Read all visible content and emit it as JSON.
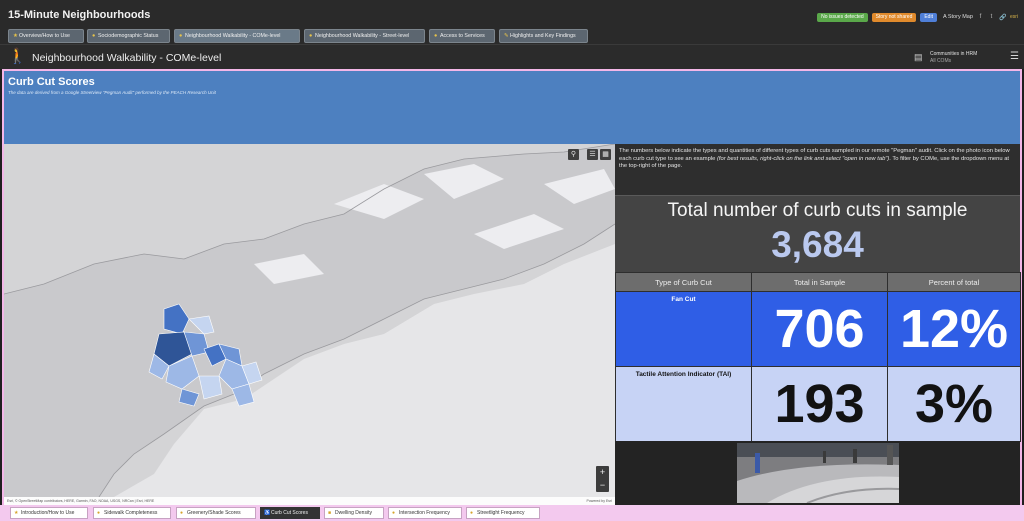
{
  "app": {
    "title": "15-Minute Neighbourhoods"
  },
  "header_right": {
    "badges": [
      {
        "label": "No issues detected",
        "color": "#5aa84a"
      },
      {
        "label": "Story not shared",
        "color": "#e08a2c"
      },
      {
        "label": "Edit",
        "color": "#4f7fd8"
      }
    ],
    "story_label": "A Story Map",
    "share_icons": [
      "facebook-icon",
      "twitter-icon",
      "link-icon"
    ],
    "esri_mark": "esri"
  },
  "tabs": [
    {
      "label": "Overview/How to Use",
      "icon": "star-icon"
    },
    {
      "label": "Sociodemographic Status",
      "icon": "people-icon"
    },
    {
      "label": "Neighbourhood Walkability - COMe-level",
      "icon": "walk-icon"
    },
    {
      "label": "Neighbourhood Walkability - Street-level",
      "icon": "street-icon"
    },
    {
      "label": "Access to Services",
      "icon": "services-icon"
    },
    {
      "label": "Highlights and Key Findings",
      "icon": "pencil-icon"
    }
  ],
  "active_tab": 2,
  "section": {
    "title": "Neighbourhood Walkability - COMe-level",
    "community_label": "Communities in HRM",
    "community_value": "All COMs"
  },
  "panel": {
    "title": "Curb Cut Scores",
    "subtitle": "The data are derived from a Google Streetview \"Pegman Audit\" performed by the PEACH Research Unit"
  },
  "intro": {
    "text_a": "The numbers below indicate the types and quantities of different types of curb cuts sampled in our remote \"Pegman\" audit. Click on the photo icon below each curb cut type to see an example ",
    "text_b": "(for best results, right-click on the link and select \"open in new tab\")",
    "text_c": ". To filter by COMe, use the dropdown menu at the top-right of the page."
  },
  "total": {
    "title": "Total number of curb cuts in sample",
    "value": "3,684"
  },
  "table": {
    "headers": [
      "Type of Curb Cut",
      "Total in Sample",
      "Percent of total"
    ],
    "rows": [
      {
        "type": "Fan Cut",
        "total": "706",
        "percent": "12%",
        "color": "#2f5ee6"
      },
      {
        "type": "Tactile Attention Indicator (TAI)",
        "total": "193",
        "percent": "3%",
        "color": "#c7d3f5"
      }
    ]
  },
  "map": {
    "attribution": "Esri, © OpenStreetMap contributors, HERE, Garmin, FAO, NOAA, USGS, NRCan | Esri, HERE",
    "powered_by": "Powered by Esri",
    "choropleth_colors": [
      "#2f5597",
      "#4472c4",
      "#6f95d6",
      "#9db8e6",
      "#c5d5f0"
    ]
  },
  "bottom_tabs": [
    {
      "label": "Introduction/How to Use",
      "icon": "star-icon"
    },
    {
      "label": "Sidewalk Completeness",
      "icon": "sidewalk-icon"
    },
    {
      "label": "Greenery/Shade Scores",
      "icon": "tree-icon"
    },
    {
      "label": "Curb Cut Scores",
      "icon": "wheelchair-icon"
    },
    {
      "label": "Dwelling Density",
      "icon": "house-icon"
    },
    {
      "label": "Intersection Frequency",
      "icon": "intersection-icon"
    },
    {
      "label": "Streetlight Frequency",
      "icon": "light-icon"
    }
  ],
  "active_bottom_tab": 3
}
